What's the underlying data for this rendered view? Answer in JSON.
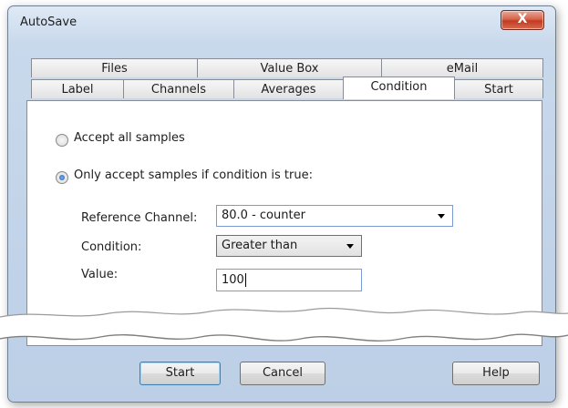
{
  "window": {
    "title": "AutoSave",
    "close_glyph": "X"
  },
  "tabs": {
    "row_back": [
      "Files",
      "Value Box",
      "eMail"
    ],
    "row_front": [
      "Label",
      "Channels",
      "Averages",
      "Condition",
      "Start"
    ],
    "active": "Condition"
  },
  "condition": {
    "accept_all_label": "Accept all samples",
    "accept_all_checked": false,
    "only_if_label": "Only accept samples if condition is true:",
    "only_if_checked": true,
    "reference_channel_label": "Reference Channel:",
    "reference_channel_value": "80.0 - counter",
    "condition_label": "Condition:",
    "condition_value": "Greater than",
    "value_label": "Value:",
    "value_value": "100"
  },
  "buttons": {
    "start": "Start",
    "cancel": "Cancel",
    "help": "Help"
  },
  "colors": {
    "selection_accent": "#3c7fb1",
    "close_red": "#c23b22"
  }
}
